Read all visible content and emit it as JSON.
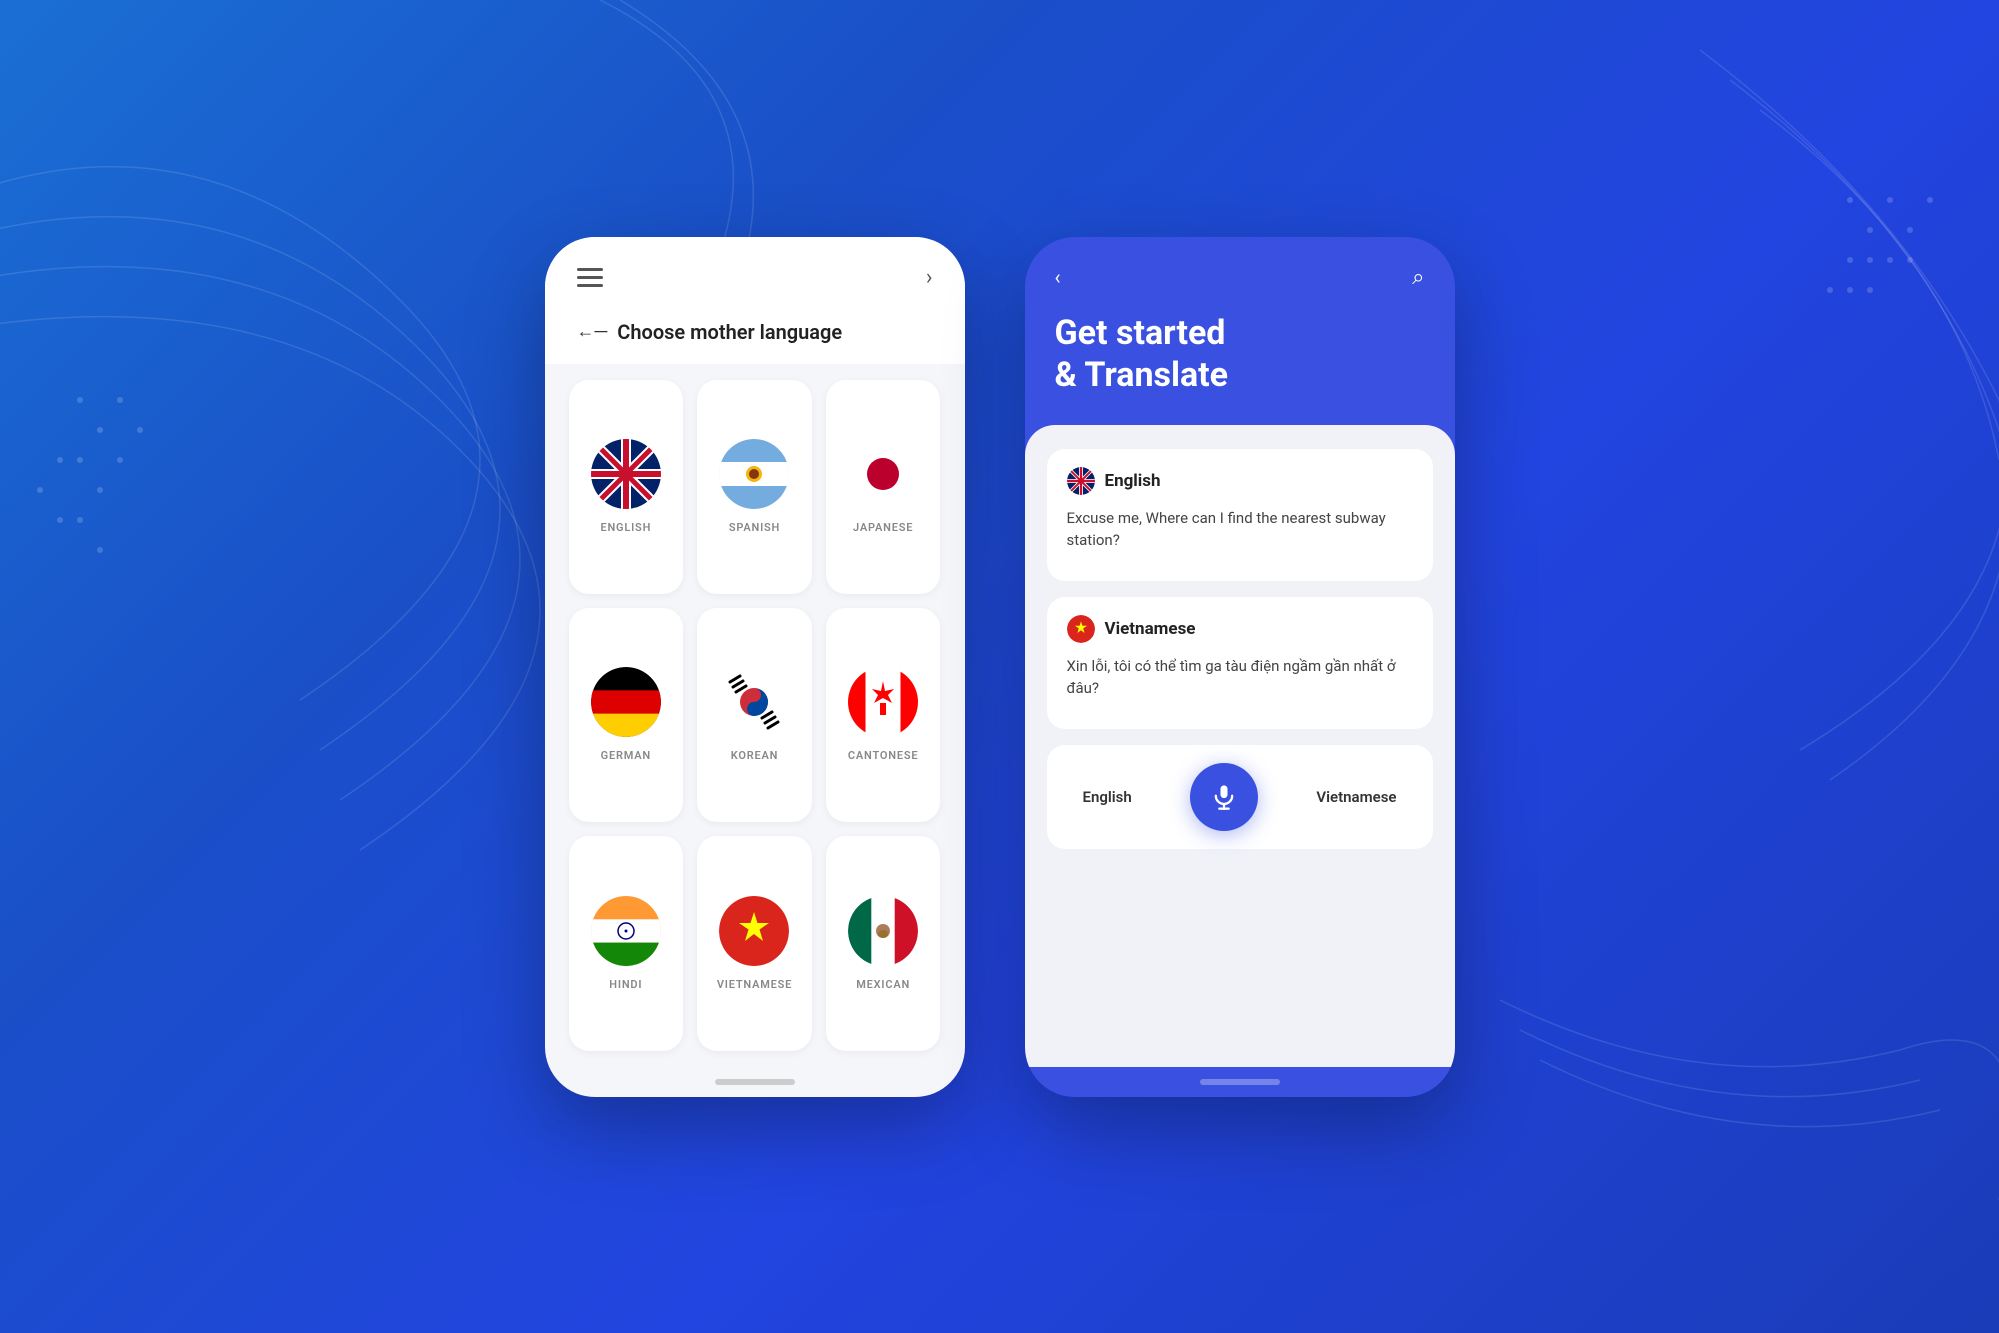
{
  "background": {
    "color_start": "#1a6fd4",
    "color_end": "#1a3cb8"
  },
  "phone_left": {
    "header": {
      "menu_label": "menu",
      "next_label": "next"
    },
    "choose_language": {
      "arrow": "←",
      "title": "Choose mother language"
    },
    "languages": [
      {
        "id": "english",
        "label": "ENGLISH",
        "flag": "🇬🇧",
        "emoji": "gb"
      },
      {
        "id": "spanish",
        "label": "SPANISH",
        "flag": "🇦🇷",
        "emoji": "ar"
      },
      {
        "id": "japanese",
        "label": "JAPANESE",
        "flag": "🇯🇵",
        "emoji": "jp"
      },
      {
        "id": "german",
        "label": "GERMAN",
        "flag": "🇩🇪",
        "emoji": "de"
      },
      {
        "id": "korean",
        "label": "KOREAN",
        "flag": "🇰🇷",
        "emoji": "kr"
      },
      {
        "id": "cantonese",
        "label": "CANTONESE",
        "flag": "🇨🇦",
        "emoji": "ca"
      },
      {
        "id": "hindi",
        "label": "HINDI",
        "flag": "🇮🇳",
        "emoji": "in"
      },
      {
        "id": "vietnamese",
        "label": "VIETNAMESE",
        "flag": "🇻🇳",
        "emoji": "vn"
      },
      {
        "id": "mexican",
        "label": "MEXICAN",
        "flag": "🇲🇽",
        "emoji": "mx"
      }
    ]
  },
  "phone_right": {
    "back_icon": "‹",
    "search_icon": "⌕",
    "title_line1": "Get started",
    "title_line2": "& Translate",
    "source_lang": {
      "name": "English",
      "text": "Excuse me, Where can I find the nearest subway station?"
    },
    "target_lang": {
      "name": "Vietnamese",
      "text": "Xin lỗi, tôi có thể tìm ga tàu điện ngầm gần nhất ở đâu?"
    },
    "bottom_left_label": "English",
    "bottom_right_label": "Vietnamese",
    "mic_label": "microphone"
  }
}
